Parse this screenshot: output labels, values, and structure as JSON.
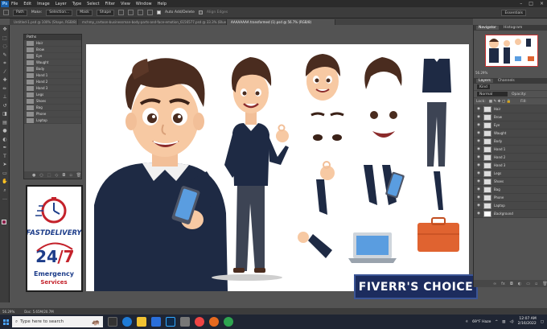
{
  "menubar": {
    "app_icon": "Ps",
    "items": [
      "File",
      "Edit",
      "Image",
      "Layer",
      "Type",
      "Select",
      "Filter",
      "View",
      "Window",
      "Help"
    ]
  },
  "optbar": {
    "mode": "Path",
    "make_label": "Make:",
    "selection_btn": "Selection...",
    "mask_btn": "Mask",
    "shape_btn": "Shape",
    "auto_add_delete": "Auto Add/Delete",
    "align_edges": "Align Edges",
    "workspace": "Essentials"
  },
  "tabs": [
    "Untitled-1.psd @ 100% (Shape, RGB/8)",
    "mchmp_cartoon-businessman-body-parts-and-face-emotion_6156577.psd @ 33.3% (Blue, RGB/8)",
    "AAAAAAAA transformed (1).psd @ 56.7% (RGB/8)"
  ],
  "paths_panel": {
    "title": "Paths",
    "items": [
      "Hair",
      "Brow",
      "Eye",
      "Waught",
      "Body",
      "Hand 1",
      "Hand 2",
      "Hand 3",
      "Legs",
      "Shoes",
      "Bag",
      "Phone",
      "Laptop"
    ]
  },
  "logo_box": {
    "fast_delivery": "FASTDELIVERY",
    "num": "24",
    "slash7": "/7",
    "emergency": "Emergency",
    "services": "Services"
  },
  "fiverr_badge": "FIVERR'S CHOICE",
  "nav_panel": {
    "tabs": [
      "Navigator",
      "Histogram"
    ],
    "zoom": "56.29%"
  },
  "layers_panel": {
    "tabs": [
      "Layers",
      "Channels"
    ],
    "kind": "Kind",
    "blend": "Normal",
    "opacity_label": "Opacity:",
    "lock_label": "Lock:",
    "fill_label": "Fill:",
    "items": [
      "Hair",
      "Brow",
      "Eye",
      "Waught",
      "Body",
      "Hand 1",
      "Hand 2",
      "Hand 3",
      "Legs",
      "Shoes",
      "Bag",
      "Phone",
      "Laptop",
      "Background"
    ]
  },
  "statusbar": {
    "zoom": "56.29%",
    "doc": "Doc: 5.65M/20.7M"
  },
  "taskbar": {
    "search_placeholder": "Type here to search",
    "weather": "69°F Haze",
    "time": "12:07 AM",
    "date": "2/16/2022"
  },
  "colors": {
    "foreground": "#8a1f4a",
    "fiverr_bg": "#1c2c5e",
    "suit": "#1e2a44",
    "skin": "#f7c9a3",
    "hair": "#4a2c1f"
  }
}
